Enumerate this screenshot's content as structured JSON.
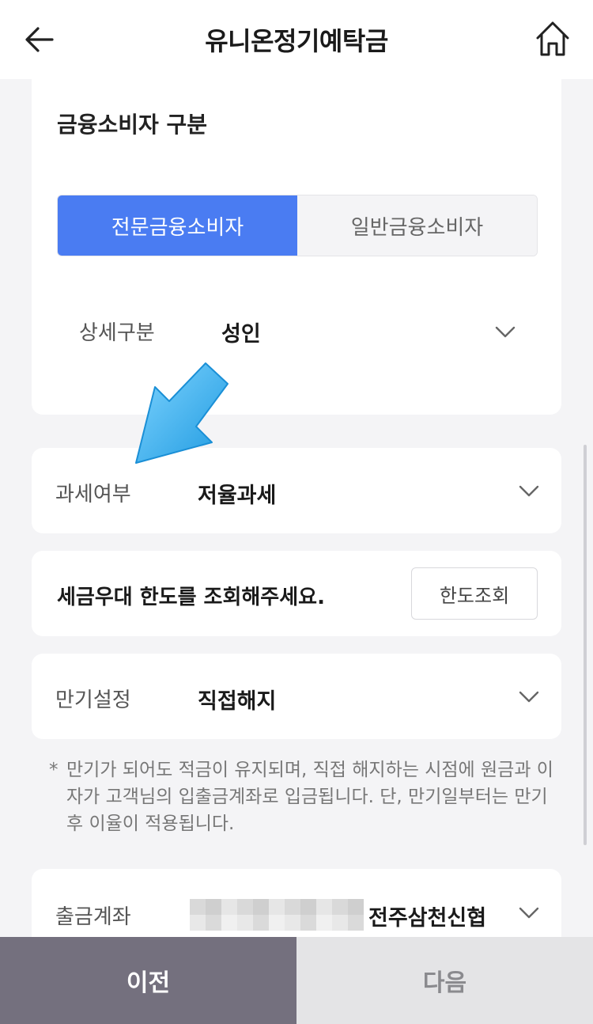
{
  "header": {
    "title": "유니온정기예탁금",
    "back_icon": "arrow-left-icon",
    "home_icon": "home-icon"
  },
  "consumer": {
    "title": "금융소비자 구분",
    "options": [
      "전문금융소비자",
      "일반금융소비자"
    ],
    "selected": "전문금융소비자",
    "detail_label": "상세구분",
    "detail_value": "성인"
  },
  "tax": {
    "label": "과세여부",
    "value": "저율과세"
  },
  "limit": {
    "text": "세금우대 한도를 조회해주세요.",
    "button_label": "한도조회"
  },
  "maturity": {
    "label": "만기설정",
    "value": "직접해지",
    "note_marker": "*",
    "note": "만기가 되어도 적금이 유지되며, 직접 해지하는 시점에 원금과 이자가 고객님의 입출금계좌로 입금됩니다. 단, 만기일부터는 만기 후 이율이 적용됩니다."
  },
  "account": {
    "label": "출금계좌",
    "bank": "전주삼천신협"
  },
  "bottom": {
    "prev_label": "이전",
    "next_label": "다음"
  },
  "colors": {
    "accent": "#4a7cf2",
    "prev_bg": "#74707e",
    "next_bg": "#e4e4e6",
    "annotation_arrow": "#3fb4f0"
  }
}
